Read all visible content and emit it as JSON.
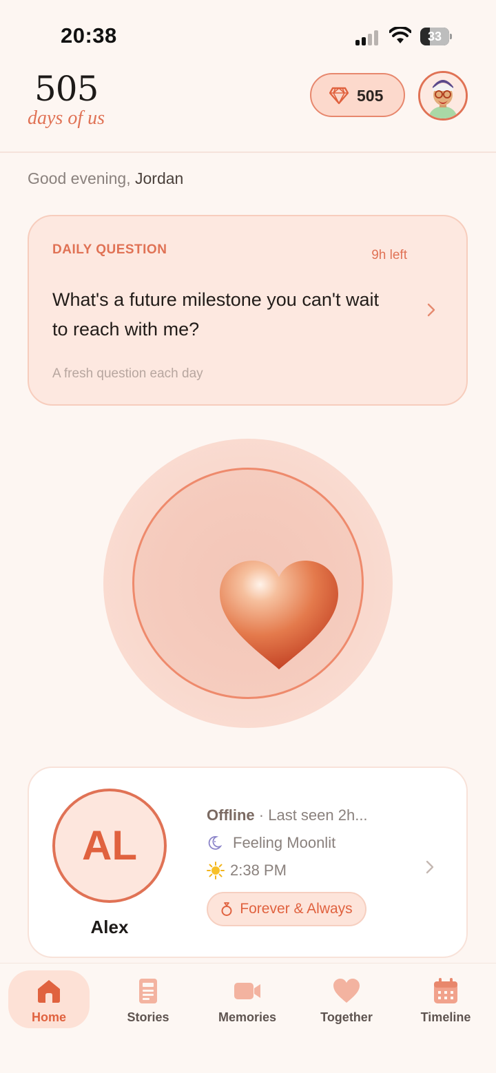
{
  "status_bar": {
    "time": "20:38",
    "battery": "33",
    "battery_level": 0.33
  },
  "header": {
    "logo_number": "505",
    "logo_subtitle": "days of us",
    "gems": "505"
  },
  "greeting": {
    "prefix": "Good evening, ",
    "name": "Jordan"
  },
  "daily_question": {
    "label": "DAILY QUESTION",
    "time_left": "9h left",
    "question": "What's a future milestone you can't wait to reach with me?",
    "footer": "A fresh question each day"
  },
  "partner": {
    "initials": "AL",
    "name": "Alex",
    "status": "Offline",
    "last_seen": " · Last seen 2h...",
    "mood": "Feeling Moonlit",
    "local_time": "2:38 PM",
    "relationship_badge": "Forever & Always"
  },
  "tabs": [
    {
      "label": "Home",
      "icon": "home-icon",
      "active": true
    },
    {
      "label": "Stories",
      "icon": "stories-icon",
      "active": false
    },
    {
      "label": "Memories",
      "icon": "video-camera-icon",
      "active": false
    },
    {
      "label": "Together",
      "icon": "heart-icon",
      "active": false
    },
    {
      "label": "Timeline",
      "icon": "calendar-icon",
      "active": false
    }
  ],
  "colors": {
    "accent": "#e07255",
    "background": "#fdf6f2",
    "card": "#fde8e0"
  }
}
